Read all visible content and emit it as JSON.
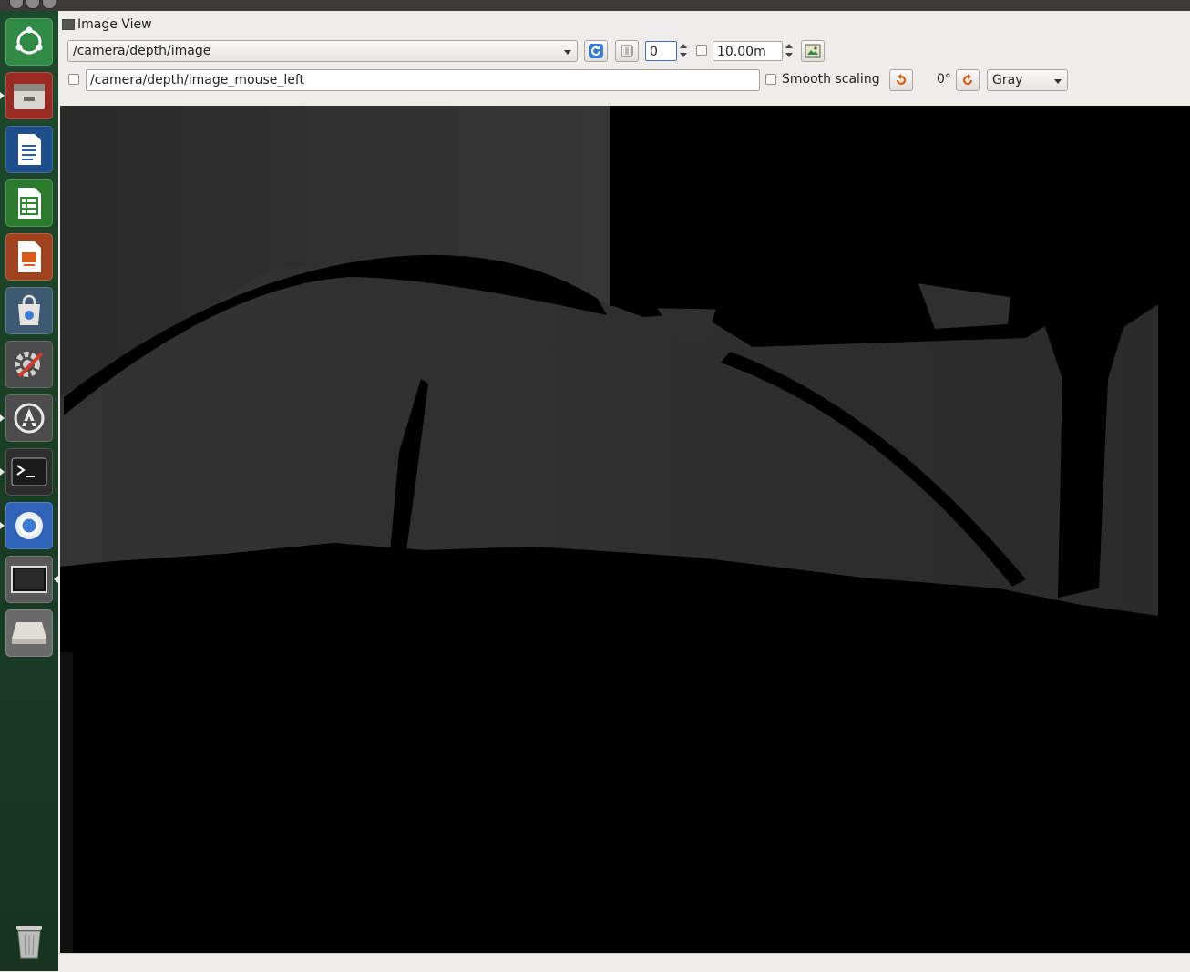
{
  "window": {
    "title": "Image View"
  },
  "launcher": {
    "items": [
      {
        "name": "ubuntu-dash-icon"
      },
      {
        "name": "files-icon"
      },
      {
        "name": "writer-icon"
      },
      {
        "name": "calc-icon"
      },
      {
        "name": "impress-icon"
      },
      {
        "name": "software-center-icon"
      },
      {
        "name": "system-settings-icon"
      },
      {
        "name": "software-updater-icon"
      },
      {
        "name": "terminal-icon"
      },
      {
        "name": "chromium-icon"
      },
      {
        "name": "display-icon"
      },
      {
        "name": "drive-icon"
      },
      {
        "name": "trash-icon"
      }
    ]
  },
  "toolbar": {
    "topic": "/camera/depth/image",
    "min_value": "0",
    "max_value": "10.00m",
    "mouse_topic": "/camera/depth/image_mouse_left",
    "smooth_scaling_label": "Smooth scaling",
    "rotation": "0°",
    "colormap": "Gray"
  },
  "colors": {
    "launcher_bg": "#1b3f27",
    "accent_orange": "#e05a13",
    "refresh_blue": "#3a7bd5",
    "viewer_bg": "#000000"
  }
}
